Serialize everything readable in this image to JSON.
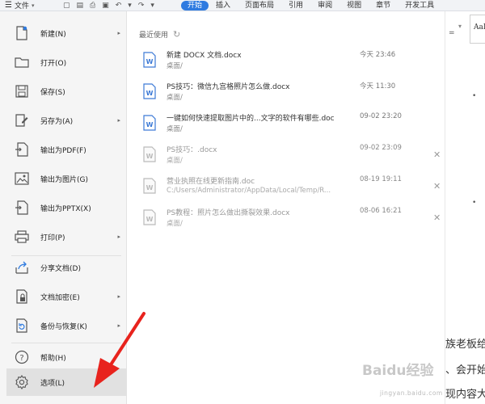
{
  "topbar": {
    "file_label": "文件",
    "tabs": [
      "开始",
      "插入",
      "页面布局",
      "引用",
      "审阅",
      "视图",
      "章节",
      "开发工具"
    ]
  },
  "menu": {
    "items": [
      {
        "label": "新建(N)",
        "icon": "new-document-icon"
      },
      {
        "label": "打开(O)",
        "icon": "folder-open-icon"
      },
      {
        "label": "保存(S)",
        "icon": "save-icon"
      },
      {
        "label": "另存为(A)",
        "icon": "save-as-icon"
      },
      {
        "label": "输出为PDF(F)",
        "icon": "export-pdf-icon"
      },
      {
        "label": "输出为图片(G)",
        "icon": "export-image-icon"
      },
      {
        "label": "输出为PPTX(X)",
        "icon": "export-pptx-icon"
      },
      {
        "label": "打印(P)",
        "icon": "printer-icon"
      },
      {
        "label": "分享文档(D)",
        "icon": "share-icon"
      },
      {
        "label": "文档加密(E)",
        "icon": "encrypt-icon"
      },
      {
        "label": "备份与恢复(K)",
        "icon": "backup-icon"
      },
      {
        "label": "帮助(H)",
        "icon": "help-icon"
      },
      {
        "label": "选项(L)",
        "icon": "gear-icon"
      }
    ]
  },
  "recent": {
    "header": "最近使用",
    "files": [
      {
        "name": "新建 DOCX 文档.docx",
        "path": "桌面/",
        "time": "今天 23:46"
      },
      {
        "name": "PS技巧：微信九宫格照片怎么做.docx",
        "path": "桌面/",
        "time": "今天 11:30"
      },
      {
        "name": "一键如何快速提取图片中的...文字的软件有哪些.doc",
        "path": "桌面/",
        "time": "09-02 23:20"
      },
      {
        "name": "PS技巧：.docx",
        "path": "桌面/",
        "time": "09-02 23:09"
      },
      {
        "name": "营业执照在线更新指南.doc",
        "path": "C:/Users/Administrator/AppData/Local/Temp/R...",
        "time": "08-19 19:11"
      },
      {
        "name": "PS教程：照片怎么做出撕裂效果.docx",
        "path": "桌面/",
        "time": "08-06 16:21"
      }
    ]
  },
  "document": {
    "style_preview": "AaBb",
    "lines": [
      "族老板给",
      "、会开始",
      "现内容大"
    ]
  },
  "watermark": {
    "text": "Baidu经验",
    "url": "jingyan.baidu.com"
  },
  "colors": {
    "accent": "#2f7be0",
    "arrow": "#e8231d",
    "word_blue": "#3d7ad6"
  }
}
